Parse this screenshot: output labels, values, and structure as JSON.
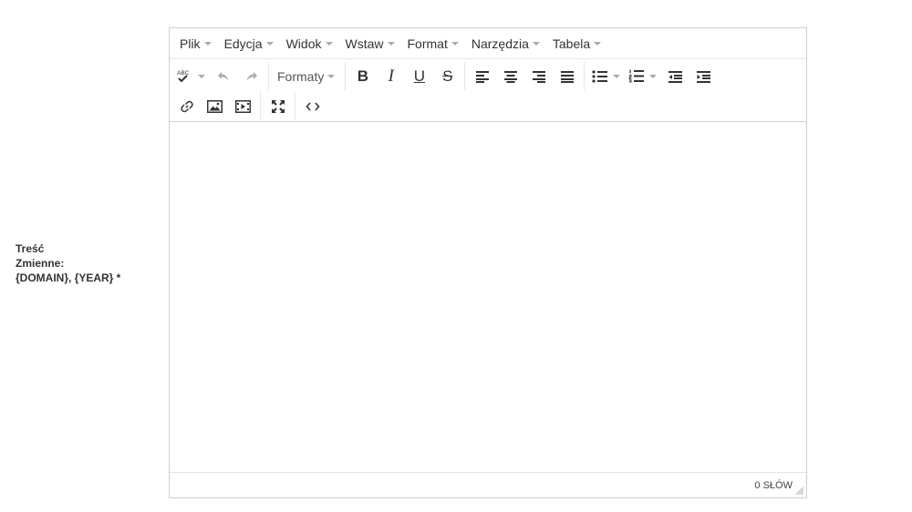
{
  "form": {
    "label_line1": "Treść",
    "label_line2": "Zmienne:",
    "label_line3": "{DOMAIN}, {YEAR} *"
  },
  "editor": {
    "menubar": [
      "Plik",
      "Edycja",
      "Widok",
      "Wstaw",
      "Format",
      "Narzędzia",
      "Tabela"
    ],
    "toolbar": {
      "spellcheck_icon_text": "ABC",
      "formats_label": "Formaty",
      "bold": "B",
      "italic": "I",
      "underline": "U",
      "strikethrough": "S"
    },
    "content": "",
    "status": {
      "wordcount": "0 SŁÓW"
    }
  }
}
